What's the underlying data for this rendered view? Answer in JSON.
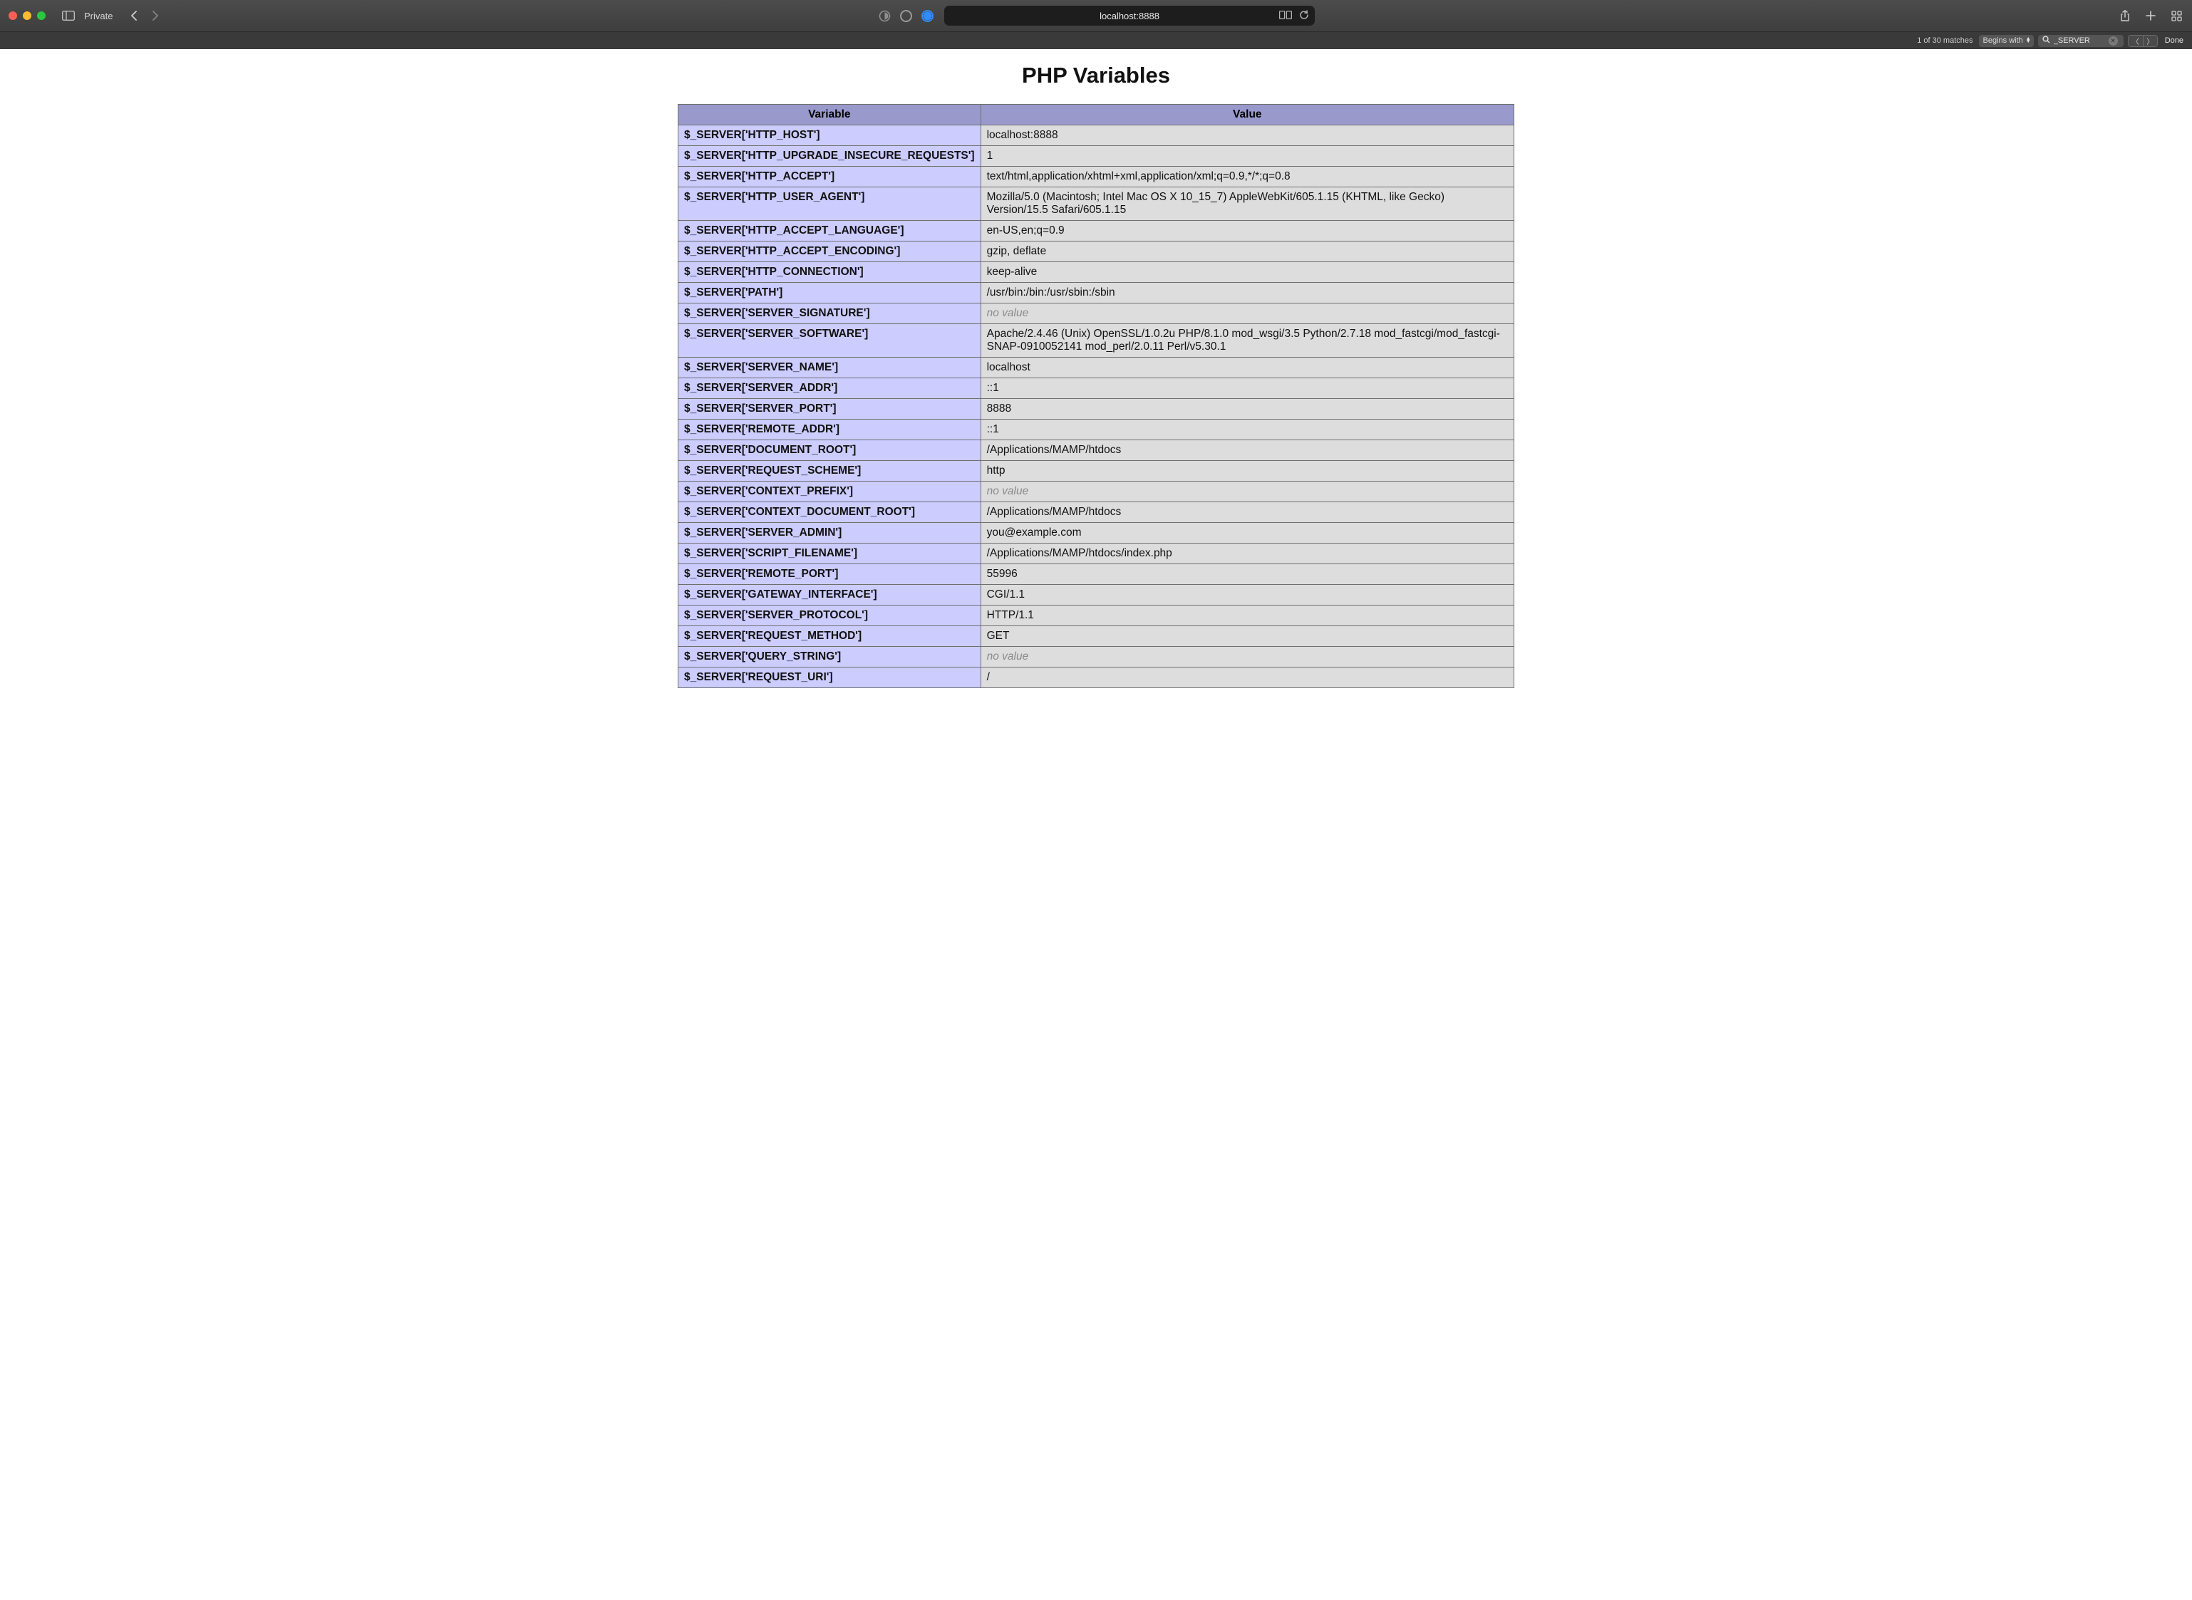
{
  "browser": {
    "private_label": "Private",
    "address": "localhost:8888"
  },
  "find": {
    "match_count": "1 of 30 matches",
    "mode_label": "Begins with",
    "query": "_SERVER",
    "done_label": "Done"
  },
  "page": {
    "title": "PHP Variables",
    "columns": {
      "variable": "Variable",
      "value": "Value"
    },
    "no_value_label": "no value",
    "rows": [
      {
        "k": "$_SERVER['HTTP_HOST']",
        "v": "localhost:8888"
      },
      {
        "k": "$_SERVER['HTTP_UPGRADE_INSECURE_REQUESTS']",
        "v": "1"
      },
      {
        "k": "$_SERVER['HTTP_ACCEPT']",
        "v": "text/html,application/xhtml+xml,application/xml;q=0.9,*/*;q=0.8"
      },
      {
        "k": "$_SERVER['HTTP_USER_AGENT']",
        "v": "Mozilla/5.0 (Macintosh; Intel Mac OS X 10_15_7) AppleWebKit/605.1.15 (KHTML, like Gecko) Version/15.5 Safari/605.1.15"
      },
      {
        "k": "$_SERVER['HTTP_ACCEPT_LANGUAGE']",
        "v": "en-US,en;q=0.9"
      },
      {
        "k": "$_SERVER['HTTP_ACCEPT_ENCODING']",
        "v": "gzip, deflate"
      },
      {
        "k": "$_SERVER['HTTP_CONNECTION']",
        "v": "keep-alive"
      },
      {
        "k": "$_SERVER['PATH']",
        "v": "/usr/bin:/bin:/usr/sbin:/sbin"
      },
      {
        "k": "$_SERVER['SERVER_SIGNATURE']",
        "v": null
      },
      {
        "k": "$_SERVER['SERVER_SOFTWARE']",
        "v": "Apache/2.4.46 (Unix) OpenSSL/1.0.2u PHP/8.1.0 mod_wsgi/3.5 Python/2.7.18 mod_fastcgi/mod_fastcgi-SNAP-0910052141 mod_perl/2.0.11 Perl/v5.30.1"
      },
      {
        "k": "$_SERVER['SERVER_NAME']",
        "v": "localhost"
      },
      {
        "k": "$_SERVER['SERVER_ADDR']",
        "v": "::1"
      },
      {
        "k": "$_SERVER['SERVER_PORT']",
        "v": "8888"
      },
      {
        "k": "$_SERVER['REMOTE_ADDR']",
        "v": "::1"
      },
      {
        "k": "$_SERVER['DOCUMENT_ROOT']",
        "v": "/Applications/MAMP/htdocs"
      },
      {
        "k": "$_SERVER['REQUEST_SCHEME']",
        "v": "http"
      },
      {
        "k": "$_SERVER['CONTEXT_PREFIX']",
        "v": null
      },
      {
        "k": "$_SERVER['CONTEXT_DOCUMENT_ROOT']",
        "v": "/Applications/MAMP/htdocs"
      },
      {
        "k": "$_SERVER['SERVER_ADMIN']",
        "v": "you@example.com"
      },
      {
        "k": "$_SERVER['SCRIPT_FILENAME']",
        "v": "/Applications/MAMP/htdocs/index.php"
      },
      {
        "k": "$_SERVER['REMOTE_PORT']",
        "v": "55996"
      },
      {
        "k": "$_SERVER['GATEWAY_INTERFACE']",
        "v": "CGI/1.1"
      },
      {
        "k": "$_SERVER['SERVER_PROTOCOL']",
        "v": "HTTP/1.1"
      },
      {
        "k": "$_SERVER['REQUEST_METHOD']",
        "v": "GET"
      },
      {
        "k": "$_SERVER['QUERY_STRING']",
        "v": null
      },
      {
        "k": "$_SERVER['REQUEST_URI']",
        "v": "/"
      }
    ]
  }
}
